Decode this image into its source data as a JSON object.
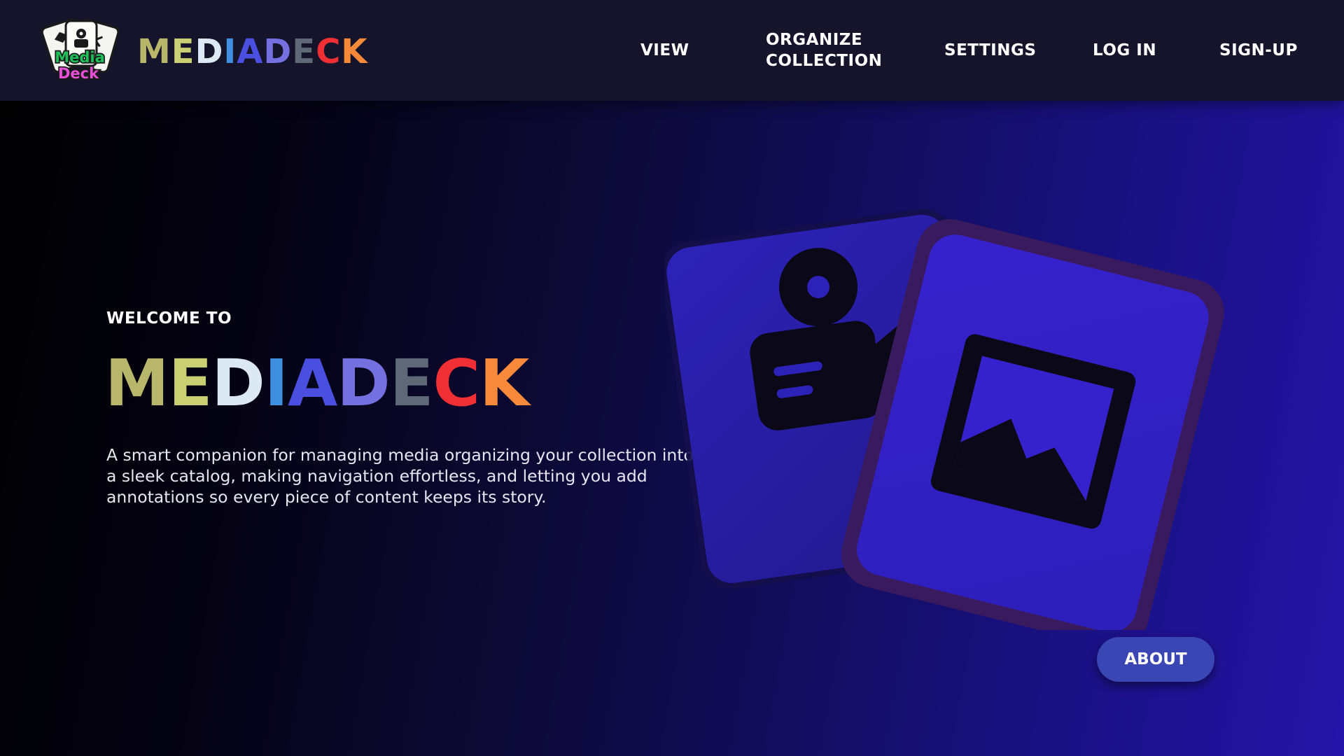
{
  "header": {
    "logo": {
      "icon": "media-deck-cards-logo",
      "line1": "Media",
      "line2": "Deck"
    },
    "brand_letters": [
      {
        "ch": "M",
        "color": "#b7b66a"
      },
      {
        "ch": "E",
        "color": "#c9cf72"
      },
      {
        "ch": "D",
        "color": "#dce9f5"
      },
      {
        "ch": "I",
        "color": "#3f8fe0"
      },
      {
        "ch": "A",
        "color": "#4a4fe0"
      },
      {
        "ch": "D",
        "color": "#7570e0"
      },
      {
        "ch": "E",
        "color": "#5f6877"
      },
      {
        "ch": "C",
        "color": "#ef2f33"
      },
      {
        "ch": "K",
        "color": "#f68a3a"
      }
    ],
    "nav": {
      "view": "VIEW",
      "organize_line1": "ORGANIZE",
      "organize_line2": "COLLECTION",
      "settings": "SETTINGS",
      "login": "LOG IN",
      "signup": "SIGN-UP"
    }
  },
  "hero": {
    "welcome": "WELCOME TO",
    "title_letters": [
      {
        "ch": "M",
        "color": "#b7b66a"
      },
      {
        "ch": "E",
        "color": "#c9cf72"
      },
      {
        "ch": "D",
        "color": "#dce9f5"
      },
      {
        "ch": "I",
        "color": "#3f8fe0"
      },
      {
        "ch": "A",
        "color": "#4a4fe0"
      },
      {
        "ch": "D",
        "color": "#7570e0"
      },
      {
        "ch": "E",
        "color": "#5f6877"
      },
      {
        "ch": "C",
        "color": "#ef2f33"
      },
      {
        "ch": "K",
        "color": "#f68a3a"
      }
    ],
    "description": "A smart companion for managing media organizing your collection into a sleek catalog, making navigation effortless, and letting you add annotations so every piece of content keeps its story.",
    "art": {
      "back_card_icon": "video-camera-icon",
      "front_card_icon": "image-icon"
    },
    "about_label": "ABOUT"
  },
  "colors": {
    "header_bg": "#15142a",
    "card_back": "#2a1fb0",
    "card_front": "#3321c8",
    "card_front_border": "#3a1a5e",
    "icon_dark": "#0b0818",
    "about_btn": "#3a46b4"
  }
}
